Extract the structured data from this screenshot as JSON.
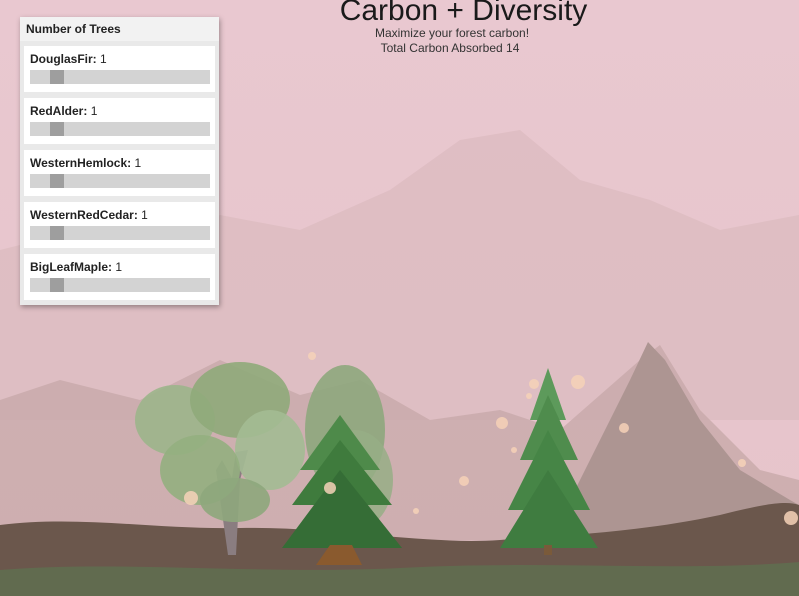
{
  "game": {
    "title": "Carbon + Diversity",
    "subtitle": "Maximize your forest carbon!",
    "carbon_label": "Total Carbon Absorbed",
    "carbon_value": "14"
  },
  "panel": {
    "header": "Number of Trees",
    "slider_min": 0,
    "slider_max": 10,
    "trees": [
      {
        "name": "DouglasFir",
        "count": 1
      },
      {
        "name": "RedAlder",
        "count": 1
      },
      {
        "name": "WesternHemlock",
        "count": 1
      },
      {
        "name": "WesternRedCedar",
        "count": 1
      },
      {
        "name": "BigLeafMaple",
        "count": 1
      }
    ]
  },
  "colors": {
    "sky": "#e8c9cf",
    "mountain_far": "#d9b7b8",
    "mountain_near": "#b19b98",
    "ground": "#6b574c",
    "grass": "#5f7050",
    "conifer": "#3e7a3f",
    "maple": "#8faa7a",
    "spore": "#f6d2b8"
  }
}
